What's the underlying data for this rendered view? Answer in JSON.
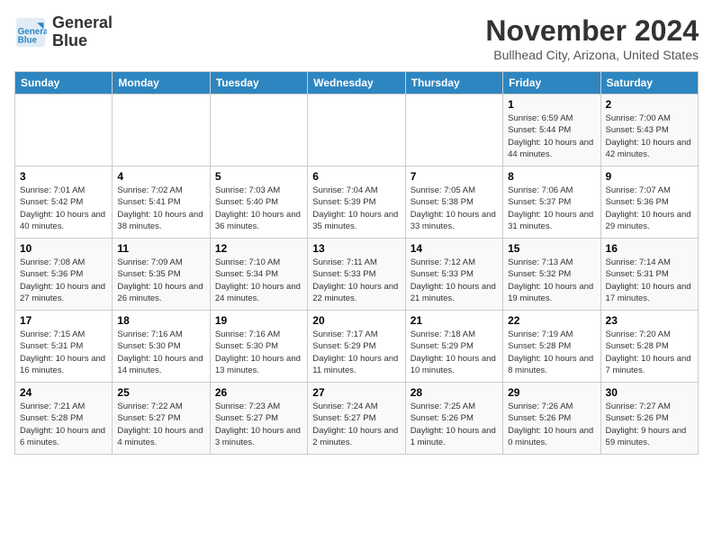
{
  "logo": {
    "line1": "General",
    "line2": "Blue"
  },
  "title": "November 2024",
  "subtitle": "Bullhead City, Arizona, United States",
  "weekdays": [
    "Sunday",
    "Monday",
    "Tuesday",
    "Wednesday",
    "Thursday",
    "Friday",
    "Saturday"
  ],
  "weeks": [
    [
      {
        "day": "",
        "info": ""
      },
      {
        "day": "",
        "info": ""
      },
      {
        "day": "",
        "info": ""
      },
      {
        "day": "",
        "info": ""
      },
      {
        "day": "",
        "info": ""
      },
      {
        "day": "1",
        "info": "Sunrise: 6:59 AM\nSunset: 5:44 PM\nDaylight: 10 hours\nand 44 minutes."
      },
      {
        "day": "2",
        "info": "Sunrise: 7:00 AM\nSunset: 5:43 PM\nDaylight: 10 hours\nand 42 minutes."
      }
    ],
    [
      {
        "day": "3",
        "info": "Sunrise: 7:01 AM\nSunset: 5:42 PM\nDaylight: 10 hours\nand 40 minutes."
      },
      {
        "day": "4",
        "info": "Sunrise: 7:02 AM\nSunset: 5:41 PM\nDaylight: 10 hours\nand 38 minutes."
      },
      {
        "day": "5",
        "info": "Sunrise: 7:03 AM\nSunset: 5:40 PM\nDaylight: 10 hours\nand 36 minutes."
      },
      {
        "day": "6",
        "info": "Sunrise: 7:04 AM\nSunset: 5:39 PM\nDaylight: 10 hours\nand 35 minutes."
      },
      {
        "day": "7",
        "info": "Sunrise: 7:05 AM\nSunset: 5:38 PM\nDaylight: 10 hours\nand 33 minutes."
      },
      {
        "day": "8",
        "info": "Sunrise: 7:06 AM\nSunset: 5:37 PM\nDaylight: 10 hours\nand 31 minutes."
      },
      {
        "day": "9",
        "info": "Sunrise: 7:07 AM\nSunset: 5:36 PM\nDaylight: 10 hours\nand 29 minutes."
      }
    ],
    [
      {
        "day": "10",
        "info": "Sunrise: 7:08 AM\nSunset: 5:36 PM\nDaylight: 10 hours\nand 27 minutes."
      },
      {
        "day": "11",
        "info": "Sunrise: 7:09 AM\nSunset: 5:35 PM\nDaylight: 10 hours\nand 26 minutes."
      },
      {
        "day": "12",
        "info": "Sunrise: 7:10 AM\nSunset: 5:34 PM\nDaylight: 10 hours\nand 24 minutes."
      },
      {
        "day": "13",
        "info": "Sunrise: 7:11 AM\nSunset: 5:33 PM\nDaylight: 10 hours\nand 22 minutes."
      },
      {
        "day": "14",
        "info": "Sunrise: 7:12 AM\nSunset: 5:33 PM\nDaylight: 10 hours\nand 21 minutes."
      },
      {
        "day": "15",
        "info": "Sunrise: 7:13 AM\nSunset: 5:32 PM\nDaylight: 10 hours\nand 19 minutes."
      },
      {
        "day": "16",
        "info": "Sunrise: 7:14 AM\nSunset: 5:31 PM\nDaylight: 10 hours\nand 17 minutes."
      }
    ],
    [
      {
        "day": "17",
        "info": "Sunrise: 7:15 AM\nSunset: 5:31 PM\nDaylight: 10 hours\nand 16 minutes."
      },
      {
        "day": "18",
        "info": "Sunrise: 7:16 AM\nSunset: 5:30 PM\nDaylight: 10 hours\nand 14 minutes."
      },
      {
        "day": "19",
        "info": "Sunrise: 7:16 AM\nSunset: 5:30 PM\nDaylight: 10 hours\nand 13 minutes."
      },
      {
        "day": "20",
        "info": "Sunrise: 7:17 AM\nSunset: 5:29 PM\nDaylight: 10 hours\nand 11 minutes."
      },
      {
        "day": "21",
        "info": "Sunrise: 7:18 AM\nSunset: 5:29 PM\nDaylight: 10 hours\nand 10 minutes."
      },
      {
        "day": "22",
        "info": "Sunrise: 7:19 AM\nSunset: 5:28 PM\nDaylight: 10 hours\nand 8 minutes."
      },
      {
        "day": "23",
        "info": "Sunrise: 7:20 AM\nSunset: 5:28 PM\nDaylight: 10 hours\nand 7 minutes."
      }
    ],
    [
      {
        "day": "24",
        "info": "Sunrise: 7:21 AM\nSunset: 5:28 PM\nDaylight: 10 hours\nand 6 minutes."
      },
      {
        "day": "25",
        "info": "Sunrise: 7:22 AM\nSunset: 5:27 PM\nDaylight: 10 hours\nand 4 minutes."
      },
      {
        "day": "26",
        "info": "Sunrise: 7:23 AM\nSunset: 5:27 PM\nDaylight: 10 hours\nand 3 minutes."
      },
      {
        "day": "27",
        "info": "Sunrise: 7:24 AM\nSunset: 5:27 PM\nDaylight: 10 hours\nand 2 minutes."
      },
      {
        "day": "28",
        "info": "Sunrise: 7:25 AM\nSunset: 5:26 PM\nDaylight: 10 hours\nand 1 minute."
      },
      {
        "day": "29",
        "info": "Sunrise: 7:26 AM\nSunset: 5:26 PM\nDaylight: 10 hours\nand 0 minutes."
      },
      {
        "day": "30",
        "info": "Sunrise: 7:27 AM\nSunset: 5:26 PM\nDaylight: 9 hours\nand 59 minutes."
      }
    ]
  ]
}
